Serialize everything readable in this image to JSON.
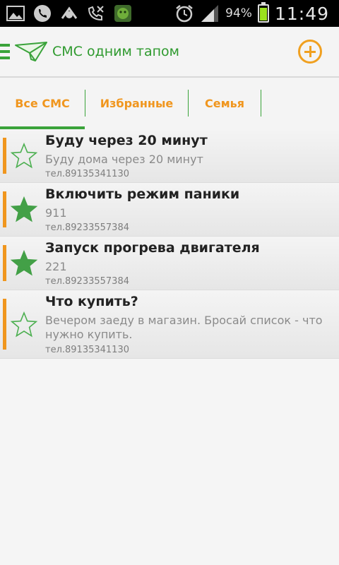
{
  "status_bar": {
    "battery_percent": "94%",
    "battery_level": 0.94,
    "time": "11:49",
    "icons": [
      "image-icon",
      "phone-icon",
      "bug-icon",
      "missed-call-icon",
      "android-app-icon",
      "alarm-icon",
      "signal-icon",
      "battery-icon"
    ]
  },
  "action_bar": {
    "title": "СМС одним тапом",
    "add_icon": "plus-circle-icon",
    "accent": "#3aa33a",
    "highlight": "#f0961e"
  },
  "tabs": [
    {
      "label": "Все СМС",
      "active": true
    },
    {
      "label": "Избранные",
      "active": false
    },
    {
      "label": "Семья",
      "active": false
    }
  ],
  "messages": [
    {
      "title": "Буду через 20 минут",
      "text": "Буду дома через 20 минут",
      "phone": "тел.89135341130",
      "favorite": false
    },
    {
      "title": "Включить режим паники",
      "text": "911",
      "phone": "тел.89233557384",
      "favorite": true
    },
    {
      "title": "Запуск прогрева двигателя",
      "text": "221",
      "phone": "тел.89233557384",
      "favorite": true
    },
    {
      "title": "Что купить?",
      "text": "Вечером заеду в магазин. Бросай список - что нужно купить.",
      "phone": "тел.89135341130",
      "favorite": false
    }
  ]
}
